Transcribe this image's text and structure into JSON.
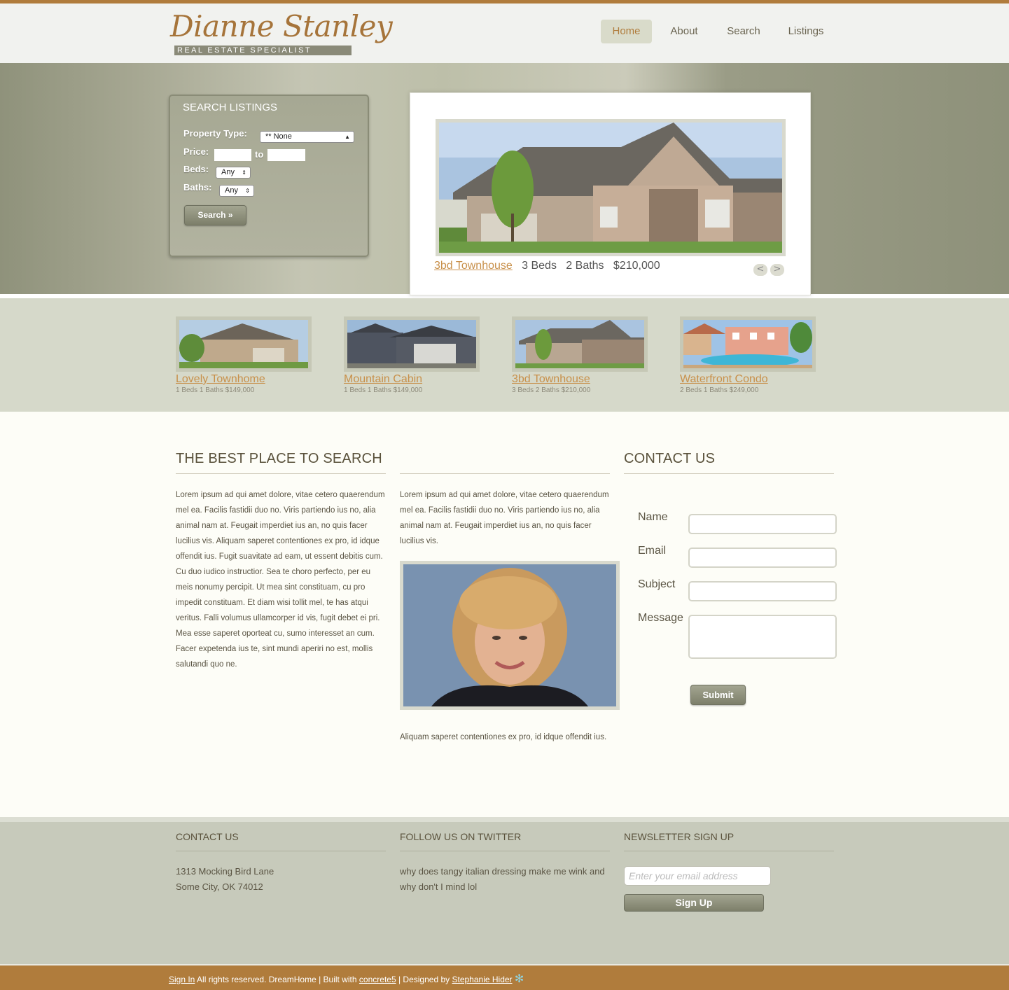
{
  "header": {
    "logo_name": "Dianne Stanley",
    "logo_tagline": "REAL ESTATE SPECIALIST",
    "nav": [
      {
        "label": "Home",
        "active": true
      },
      {
        "label": "About",
        "active": false
      },
      {
        "label": "Search",
        "active": false
      },
      {
        "label": "Listings",
        "active": false
      }
    ]
  },
  "search": {
    "title": "SEARCH LISTINGS",
    "property_type_label": "Property Type:",
    "property_type_value": "** None",
    "price_label": "Price:",
    "price_to": "to",
    "beds_label": "Beds:",
    "beds_value": "Any",
    "baths_label": "Baths:",
    "baths_value": "Any",
    "button": "Search »"
  },
  "slider": {
    "title": "3bd Townhouse",
    "beds": "3 Beds",
    "baths": "2 Baths",
    "price": "$210,000",
    "prev": "<",
    "next": ">"
  },
  "listings": [
    {
      "title": "Lovely Townhome",
      "meta": "1 Beds  1 Baths  $149,000"
    },
    {
      "title": "Mountain Cabin",
      "meta": "1 Beds  1 Baths  $149,000"
    },
    {
      "title": "3bd Townhouse",
      "meta": "3 Beds  2 Baths  $210,000"
    },
    {
      "title": "Waterfront Condo",
      "meta": "2 Beds  1 Baths  $249,000"
    }
  ],
  "main": {
    "left_title": "THE BEST PLACE TO SEARCH",
    "left_text": "Lorem ipsum ad qui amet dolore, vitae cetero quaerendum mel ea. Facilis fastidii duo no. Viris partiendo ius no, alia animal nam at. Feugait imperdiet ius an, no quis facer lucilius vis. Aliquam saperet contentiones ex pro, id idque offendit ius. Fugit suavitate ad eam, ut essent debitis cum. Cu duo iudico instructior. Sea te choro perfecto, per eu meis nonumy percipit. Ut mea sint constituam, cu pro impedit constituam. Et diam wisi tollit mel, te has atqui veritus. Falli volumus ullamcorper id vis, fugit debet ei pri. Mea esse saperet oporteat cu, sumo interesset an cum. Facer expetenda ius te, sint mundi aperiri no est, mollis salutandi quo ne.",
    "mid_text": "Lorem ipsum ad qui amet dolore, vitae cetero quaerendum mel ea. Facilis fastidii duo no. Viris partiendo ius no, alia animal nam at. Feugait imperdiet ius an, no quis facer lucilius vis.",
    "mid_caption": "Aliquam saperet contentiones ex pro, id idque offendit ius.",
    "contact_title": "CONTACT US",
    "contact_fields": [
      "Name",
      "Email",
      "Subject",
      "Message"
    ],
    "submit": "Submit"
  },
  "footer": {
    "contact_title": "CONTACT US",
    "address_line1": "1313 Mocking Bird Lane",
    "address_line2": "Some City, OK 74012",
    "twitter_title": "FOLLOW US ON TWITTER",
    "tweet": "why does tangy italian dressing make me wink and why don't I mind lol",
    "newsletter_title": "NEWSLETTER SIGN UP",
    "email_placeholder": "Enter your email address",
    "signup": "Sign Up"
  },
  "bottom": {
    "sign_in": "Sign In",
    "rights": "All rights reserved. DreamHome",
    "built_with": "Built with",
    "concrete5": "concrete5",
    "designed_by": "Designed by",
    "designer": "Stephanie Hider"
  },
  "colors": {
    "accent": "#b07c3c",
    "link": "#c8904a",
    "hero": "#8f927b",
    "listings_band": "#d6d9ca",
    "footer": "#c7cabb"
  }
}
